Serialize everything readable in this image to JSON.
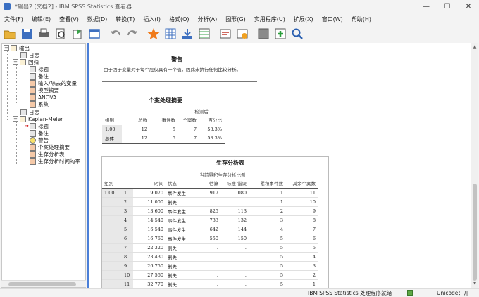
{
  "window": {
    "title": "*输出2 [文档2] - IBM SPSS Statistics 查看器",
    "controls": [
      "—",
      "☐",
      "✕"
    ]
  },
  "menu": [
    "文件(F)",
    "编辑(E)",
    "查看(V)",
    "数据(D)",
    "转换(T)",
    "插入(I)",
    "格式(O)",
    "分析(A)",
    "图形(G)",
    "实用程序(U)",
    "扩展(X)",
    "窗口(W)",
    "帮助(H)"
  ],
  "toolbar_icons": [
    "open-icon",
    "save-icon",
    "print-icon",
    "print-preview-icon",
    "export-icon",
    "recall-dialog-icon",
    "undo-icon",
    "redo-icon",
    "goto-data-icon",
    "goto-case-icon",
    "goto-variable-icon",
    "variables-icon",
    "insert-heading-icon",
    "insert-title-icon",
    "hide-icon",
    "designate-window-icon",
    "search-icon"
  ],
  "tree": [
    {
      "label": "输出",
      "level": 0,
      "icon": "output",
      "expander": "−"
    },
    {
      "label": "日志",
      "level": 1,
      "icon": "log"
    },
    {
      "label": "回归",
      "level": 1,
      "icon": "output",
      "expander": "−"
    },
    {
      "label": "标题",
      "level": 2,
      "icon": "log"
    },
    {
      "label": "备注",
      "level": 2,
      "icon": "log"
    },
    {
      "label": "输入/除去的变量",
      "level": 2,
      "icon": "red"
    },
    {
      "label": "模型摘要",
      "level": 2,
      "icon": "red"
    },
    {
      "label": "ANOVA",
      "level": 2,
      "icon": "red"
    },
    {
      "label": "系数",
      "level": 2,
      "icon": "red"
    },
    {
      "label": "日志",
      "level": 1,
      "icon": "log"
    },
    {
      "label": "Kaplan-Meier",
      "level": 1,
      "icon": "output",
      "expander": "−"
    },
    {
      "label": "标题",
      "level": 2,
      "icon": "log",
      "current": true
    },
    {
      "label": "备注",
      "level": 2,
      "icon": "log"
    },
    {
      "label": "警告",
      "level": 2,
      "icon": "warn"
    },
    {
      "label": "个案处理摘要",
      "level": 2,
      "icon": "red"
    },
    {
      "label": "生存分析表",
      "level": 2,
      "icon": "red"
    },
    {
      "label": "生存分析时间的平",
      "level": 2,
      "icon": "red"
    }
  ],
  "warning": {
    "title": "警告",
    "text": "由于因子变量对于每个层仅具有一个值，因此未执行任何比较分析。"
  },
  "case_summary": {
    "title": "个案处理摘要",
    "header_censored": "检测后",
    "columns": [
      "组别",
      "总数",
      "事件数",
      "个案数",
      "百分比"
    ],
    "rows": [
      {
        "group": "1.00",
        "total": "12",
        "events": "5",
        "n": "7",
        "pct": "58.3%"
      },
      {
        "group": "总体",
        "total": "12",
        "events": "5",
        "n": "7",
        "pct": "58.3%"
      }
    ]
  },
  "survival_table": {
    "title": "生存分析表",
    "header_group": "当前累积生存分析比例",
    "columns": [
      "组别",
      "",
      "时间",
      "状态",
      "估算",
      "标准 错误",
      "累积事件数",
      "其余个案数"
    ],
    "group": "1.00",
    "rows": [
      {
        "i": "1",
        "time": "9.070",
        "status": "事件发生",
        "est": ".917",
        "se": ".080",
        "cum": "1",
        "rem": "11"
      },
      {
        "i": "2",
        "time": "11.000",
        "status": "删失",
        "est": ".",
        "se": ".",
        "cum": "1",
        "rem": "10"
      },
      {
        "i": "3",
        "time": "13.600",
        "status": "事件发生",
        "est": ".825",
        "se": ".113",
        "cum": "2",
        "rem": "9"
      },
      {
        "i": "4",
        "time": "14.540",
        "status": "事件发生",
        "est": ".733",
        "se": ".132",
        "cum": "3",
        "rem": "8"
      },
      {
        "i": "5",
        "time": "16.540",
        "status": "事件发生",
        "est": ".642",
        "se": ".144",
        "cum": "4",
        "rem": "7"
      },
      {
        "i": "6",
        "time": "16.760",
        "status": "事件发生",
        "est": ".550",
        "se": ".150",
        "cum": "5",
        "rem": "6"
      },
      {
        "i": "7",
        "time": "22.320",
        "status": "删失",
        "est": ".",
        "se": ".",
        "cum": "5",
        "rem": "5"
      },
      {
        "i": "8",
        "time": "23.430",
        "status": "删失",
        "est": ".",
        "se": ".",
        "cum": "5",
        "rem": "4"
      },
      {
        "i": "9",
        "time": "26.750",
        "status": "删失",
        "est": ".",
        "se": ".",
        "cum": "5",
        "rem": "3"
      },
      {
        "i": "10",
        "time": "27.560",
        "status": "删失",
        "est": ".",
        "se": ".",
        "cum": "5",
        "rem": "2"
      },
      {
        "i": "11",
        "time": "32.770",
        "status": "删失",
        "est": ".",
        "se": ".",
        "cum": "5",
        "rem": "1"
      }
    ]
  },
  "status": {
    "processor": "IBM SPSS Statistics 处理程序就绪",
    "unicode": "Unicode：开"
  },
  "colors": {
    "accent": "#4b7fd8",
    "row_header": "#e8e8e8"
  }
}
